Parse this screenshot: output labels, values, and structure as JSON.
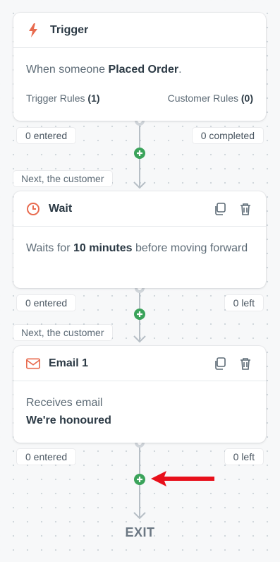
{
  "trigger": {
    "title": "Trigger",
    "icon": "lightning-icon",
    "body_prefix": "When someone ",
    "body_event": "Placed Order",
    "body_suffix": ".",
    "trigger_rules_label": "Trigger Rules",
    "trigger_rules_count": "(1)",
    "customer_rules_label": "Customer Rules",
    "customer_rules_count": "(0)",
    "stat_left": "0 entered",
    "stat_right": "0 completed"
  },
  "connector_label": "Next, the customer",
  "wait": {
    "title": "Wait",
    "icon": "clock-icon",
    "body_prefix": "Waits for ",
    "body_duration": "10 minutes",
    "body_suffix": " before moving forward",
    "stat_left": "0 entered",
    "stat_right": "0 left"
  },
  "email": {
    "title": "Email 1",
    "icon": "envelope-icon",
    "body_line1": "Receives email",
    "body_subject": "We're honoured",
    "stat_left": "0 entered",
    "stat_right": "0 left"
  },
  "exit_label": "EXIT",
  "colors": {
    "accent": "#e86b4f",
    "add_button": "#3aa35a",
    "annotation_arrow": "#e8101b",
    "line": "#b7bfc6"
  }
}
